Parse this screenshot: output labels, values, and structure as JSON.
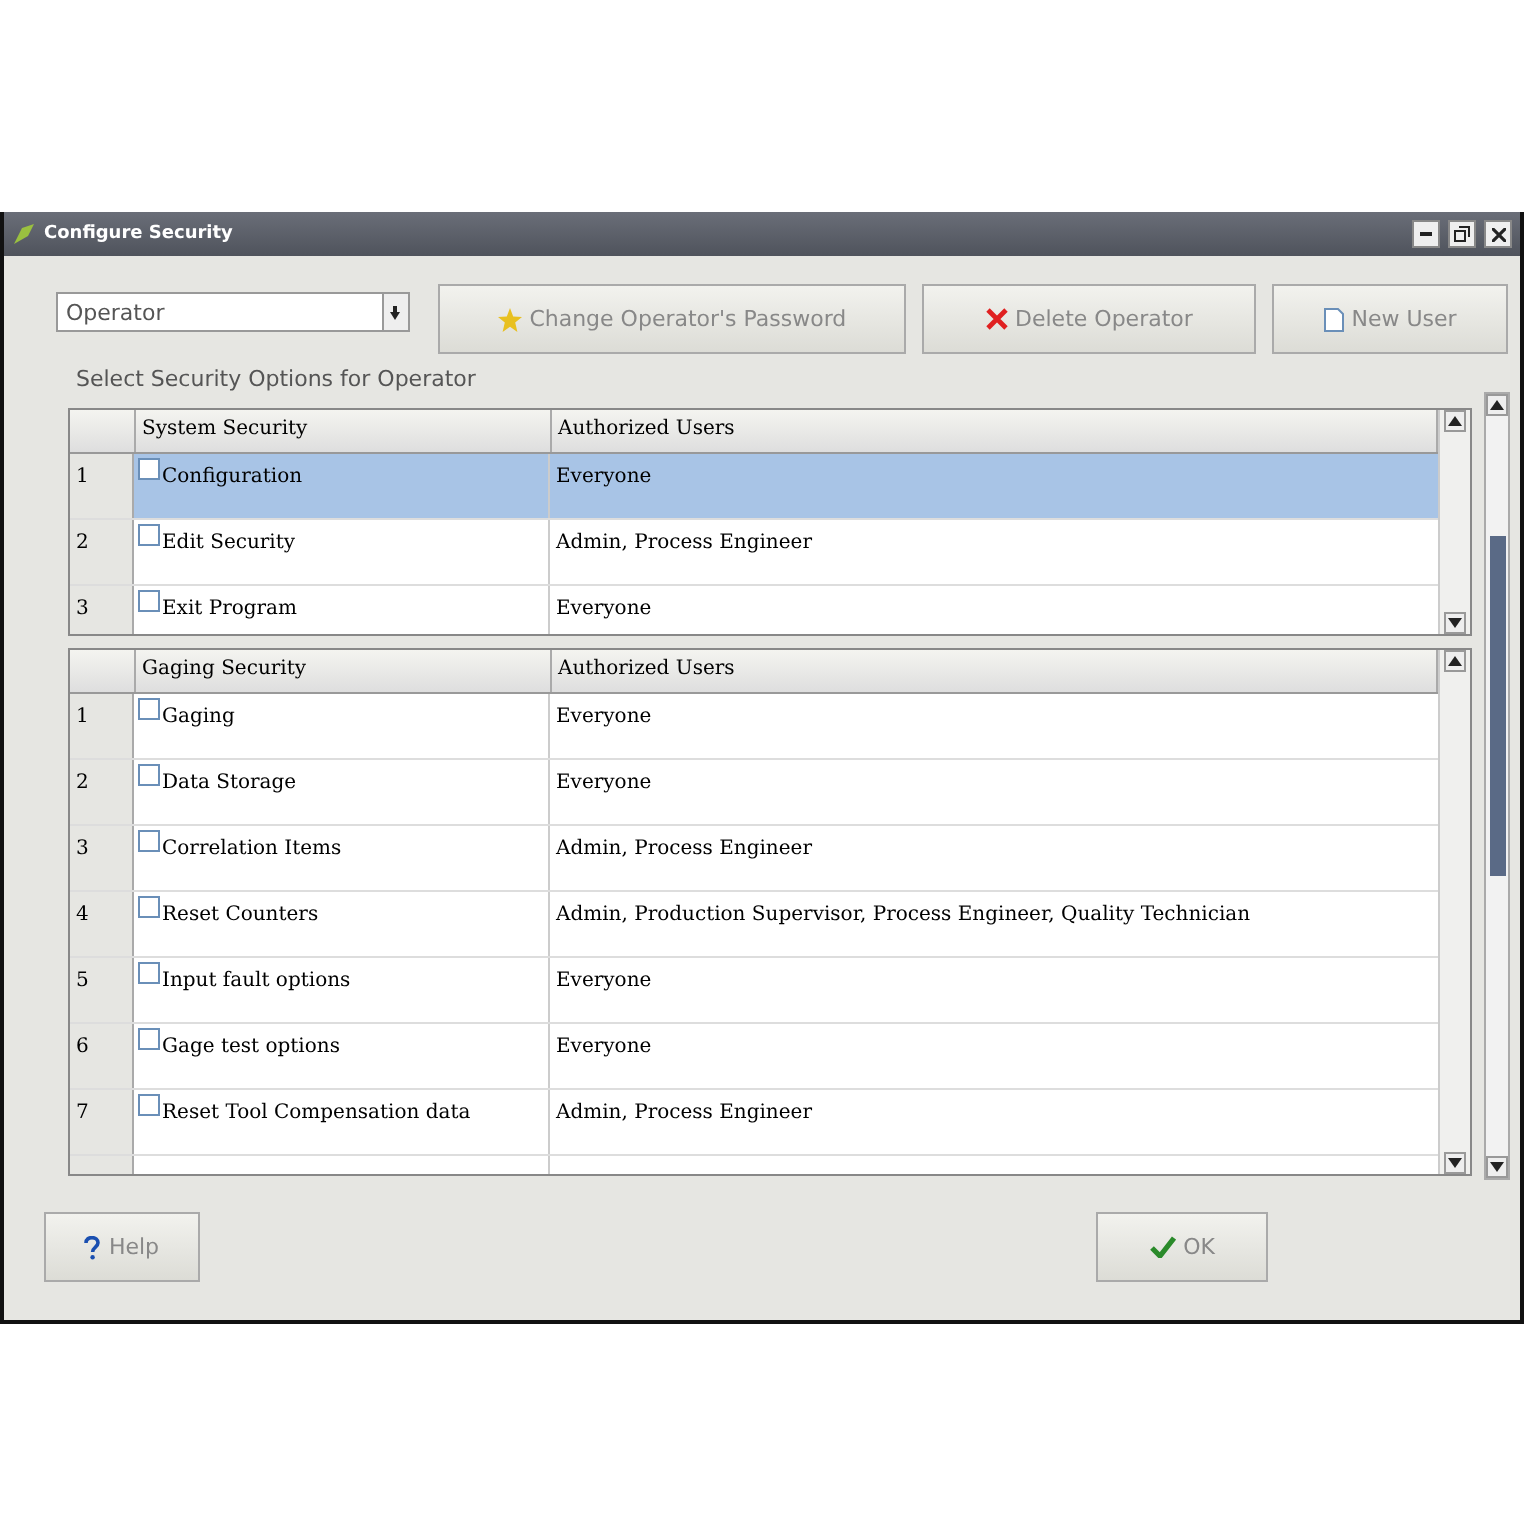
{
  "window": {
    "title": "Configure Security"
  },
  "operator_select": {
    "value": "Operator"
  },
  "buttons": [
    {
      "kind": "star",
      "label": "Change Operator's Password"
    },
    {
      "kind": "delete",
      "label": "Delete Operator"
    },
    {
      "kind": "new",
      "label": "New User"
    }
  ],
  "options_label": "Select Security Options for Operator",
  "tables": [
    {
      "columns": [
        "System Security",
        "Authorized Users"
      ],
      "rows": [
        {
          "number": "1",
          "name": "Configuration",
          "users": "Everyone",
          "checked": false,
          "selected": true
        },
        {
          "number": "2",
          "name": "Edit Security",
          "users": "Admin, Process Engineer",
          "checked": false,
          "selected": false
        },
        {
          "number": "3",
          "name": "Exit Program",
          "users": "Everyone",
          "checked": false,
          "selected": false
        }
      ]
    },
    {
      "columns": [
        "Gaging Security",
        "Authorized Users"
      ],
      "rows": [
        {
          "number": "1",
          "name": "Gaging",
          "users": "Everyone",
          "checked": false,
          "selected": false
        },
        {
          "number": "2",
          "name": "Data Storage",
          "users": "Everyone",
          "checked": false,
          "selected": false
        },
        {
          "number": "3",
          "name": "Correlation Items",
          "users": "Admin, Process Engineer",
          "checked": false,
          "selected": false
        },
        {
          "number": "4",
          "name": "Reset Counters",
          "users": "Admin, Production Supervisor, Process Engineer, Quality Technician",
          "checked": false,
          "selected": false
        },
        {
          "number": "5",
          "name": "Input fault options",
          "users": "Everyone",
          "checked": false,
          "selected": false
        },
        {
          "number": "6",
          "name": "Gage test options",
          "users": "Everyone",
          "checked": false,
          "selected": false
        },
        {
          "number": "7",
          "name": "Reset Tool Compensation data",
          "users": "Admin, Process Engineer",
          "checked": false,
          "selected": false
        }
      ]
    }
  ],
  "footer_buttons": [
    {
      "kind": "help",
      "label": "Help"
    },
    {
      "kind": "ok",
      "label": "OK"
    }
  ]
}
